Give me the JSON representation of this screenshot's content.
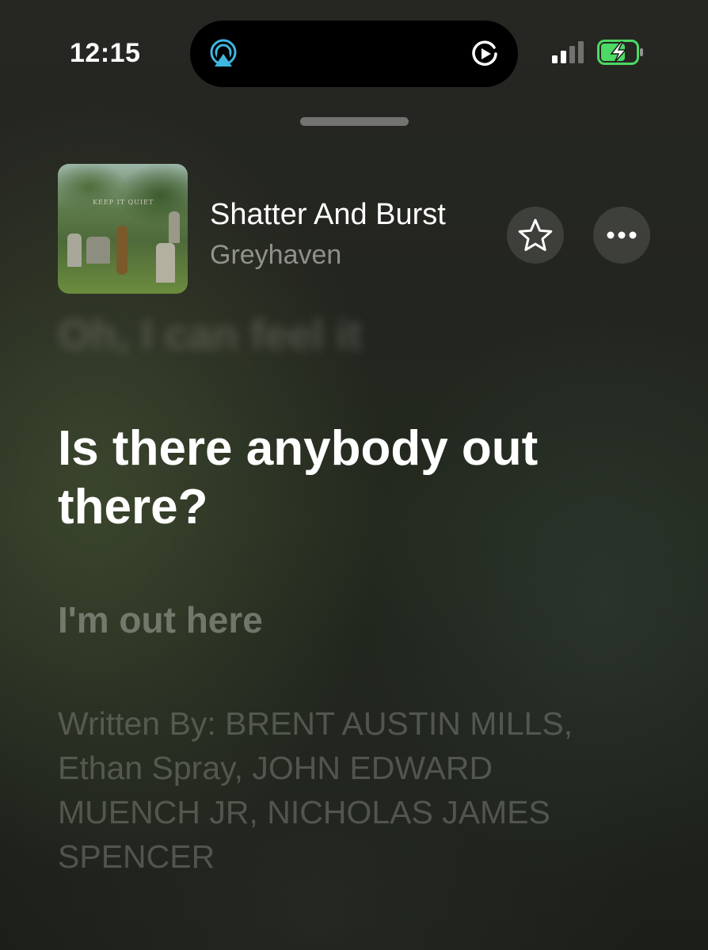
{
  "status_bar": {
    "time": "12:15"
  },
  "now_playing": {
    "artwork_text": "KEEP IT QUIET",
    "title": "Shatter And Burst",
    "artist": "Greyhaven"
  },
  "lyrics": {
    "previous_line": "Oh, I can feel it",
    "current_line": "Is there anybody out there?",
    "next_line": "I'm out here",
    "credits": "Written By: BRENT AUSTIN MILLS, Ethan Spray, JOHN EDWARD MUENCH JR, NICHOLAS JAMES SPENCER"
  },
  "colors": {
    "airplay_accent": "#3fb6e0",
    "battery_charging": "#4cd964"
  },
  "icons": {
    "island_left": "airplay-audio-icon",
    "island_right": "play-circle-icon",
    "favorite": "star-icon",
    "more": "ellipsis-icon"
  }
}
